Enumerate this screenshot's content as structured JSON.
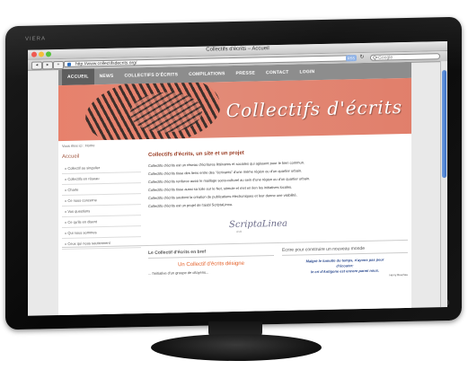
{
  "monitor": {
    "brand": "VIERA"
  },
  "browser": {
    "window_title": "Collectifs d'écrits – Accueil",
    "url": "http://www.collectifsdecrits.org/",
    "rss_label": "RSS",
    "reload_symbol": "↻",
    "search_placeholder": "Google",
    "search_icon": "Q•"
  },
  "nav": {
    "items": [
      "ACCUEIL",
      "NEWS",
      "COLLECTIFS D'ÉCRITS",
      "COMPILATIONS",
      "PRESSE",
      "CONTACT",
      "LOGIN"
    ]
  },
  "banner": {
    "title": "Collectifs d'écrits"
  },
  "breadcrumb": "Vous êtes ici : Home",
  "sidebar": {
    "heading": "Accueil",
    "items": [
      "Collectif au singulier",
      "Collectifs en réseau",
      "Charte",
      "Ce nous concerne",
      "Vos questions",
      "Ce qu'ils en disent",
      "Qui nous sommes",
      "Ceux qui nous soutiennent"
    ]
  },
  "main": {
    "heading": "Collectifs d'écrits, un site et un projet",
    "paragraphs": [
      "Collectifs d'écrits est un réseau d'écritures littéraires et sociales qui agissent pour le bien commun.",
      "Collectifs d'écrits tisse des liens entre des \"écrivants\" d'une même région ou d'un quartier urbain.",
      "Collectifs d'écrits renforce aussi le maillage socio-culturel au sein d'une région ou d'un quartier urbain.",
      "Collectifs d'écrits tisse aussi sa toile sur le Net, stimule et met en lien les initiatives locales.",
      "Collectifs d'écrits soutient la création de publications électroniques et leur donne une visibilité.",
      "Collectifs d'écrits est un projet de l'aisbl ScriptaLinea."
    ],
    "signature": "ScriptaLinea",
    "signature_sub": "aisbl"
  },
  "box_left": {
    "heading": "Le Collectif d'écrits en bref",
    "highlight": "Un Collectif d'écrits désigne",
    "text": "... l'initiative d'un groupe de citoyens..."
  },
  "box_right": {
    "heading": "Ecrire pour construire un nouveau monde",
    "quote_lines": [
      "Malgré le tumulte du temps, n'ayons pas peur",
      "d'écouter:",
      "le cri d'Antigone est encore parmi nous."
    ],
    "author": "Henry Bauchau"
  },
  "colors": {
    "nav_bg": "#8d8d8d",
    "nav_active": "#5e5e5e",
    "banner": "#e7816c",
    "heading": "#993b22",
    "orange": "#e4612a",
    "quote": "#2b4a8f"
  }
}
